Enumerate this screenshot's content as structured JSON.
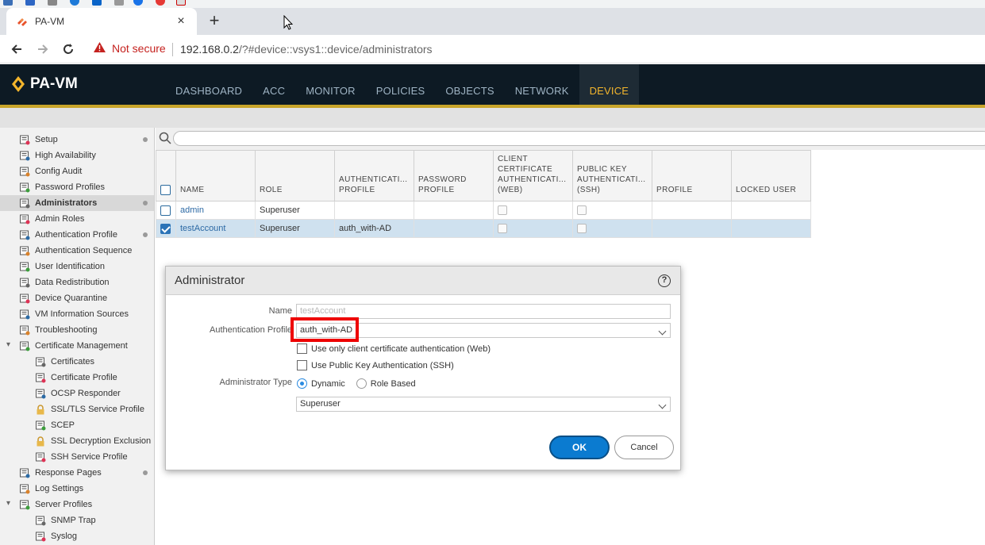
{
  "browser": {
    "tab_title": "PA-VM",
    "new_tab_label": "+",
    "security_label": "Not secure",
    "url_host": "192.168.0.2",
    "url_path": "/?#device::vsys1::device/administrators"
  },
  "app": {
    "logo": "PA-VM",
    "nav": [
      {
        "label": "DASHBOARD"
      },
      {
        "label": "ACC"
      },
      {
        "label": "MONITOR"
      },
      {
        "label": "POLICIES"
      },
      {
        "label": "OBJECTS"
      },
      {
        "label": "NETWORK"
      },
      {
        "label": "DEVICE",
        "active": true
      }
    ],
    "accent": "#f3b52c"
  },
  "sidebar": {
    "items": [
      {
        "label": "Setup",
        "icon": "setup-icon",
        "dot": true
      },
      {
        "label": "High Availability",
        "icon": "high-availability-icon"
      },
      {
        "label": "Config Audit",
        "icon": "config-audit-icon"
      },
      {
        "label": "Password Profiles",
        "icon": "password-profiles-icon"
      },
      {
        "label": "Administrators",
        "icon": "administrators-icon",
        "selected": true,
        "dot": true
      },
      {
        "label": "Admin Roles",
        "icon": "admin-roles-icon"
      },
      {
        "label": "Authentication Profile",
        "icon": "authentication-profile-icon",
        "dot": true
      },
      {
        "label": "Authentication Sequence",
        "icon": "authentication-sequence-icon"
      },
      {
        "label": "User Identification",
        "icon": "user-identification-icon"
      },
      {
        "label": "Data Redistribution",
        "icon": "data-redistribution-icon"
      },
      {
        "label": "Device Quarantine",
        "icon": "device-quarantine-icon"
      },
      {
        "label": "VM Information Sources",
        "icon": "vm-information-sources-icon"
      },
      {
        "label": "Troubleshooting",
        "icon": "troubleshooting-icon"
      },
      {
        "label": "Certificate Management",
        "icon": "certificate-management-icon",
        "expanded": true
      },
      {
        "label": "Certificates",
        "icon": "certificates-icon",
        "child": true
      },
      {
        "label": "Certificate Profile",
        "icon": "certificate-profile-icon",
        "child": true
      },
      {
        "label": "OCSP Responder",
        "icon": "ocsp-responder-icon",
        "child": true
      },
      {
        "label": "SSL/TLS Service Profile",
        "icon": "lock-icon",
        "child": true
      },
      {
        "label": "SCEP",
        "icon": "scep-icon",
        "child": true
      },
      {
        "label": "SSL Decryption Exclusion",
        "icon": "lock-icon",
        "child": true
      },
      {
        "label": "SSH Service Profile",
        "icon": "ssh-service-profile-icon",
        "child": true
      },
      {
        "label": "Response Pages",
        "icon": "response-pages-icon",
        "dot": true
      },
      {
        "label": "Log Settings",
        "icon": "log-settings-icon"
      },
      {
        "label": "Server Profiles",
        "icon": "server-profiles-icon",
        "expanded": true
      },
      {
        "label": "SNMP Trap",
        "icon": "snmp-trap-icon",
        "child": true
      },
      {
        "label": "Syslog",
        "icon": "syslog-icon",
        "child": true
      }
    ]
  },
  "table": {
    "columns": [
      "NAME",
      "ROLE",
      "AUTHENTICATI... PROFILE",
      "PASSWORD PROFILE",
      "CLIENT CERTIFICATE AUTHENTICATI... (WEB)",
      "PUBLIC KEY AUTHENTICATI... (SSH)",
      "PROFILE",
      "LOCKED USER"
    ],
    "rows": [
      {
        "name": "admin",
        "role": "Superuser",
        "auth_profile": "",
        "password_profile": "",
        "selected": false
      },
      {
        "name": "testAccount",
        "role": "Superuser",
        "auth_profile": "auth_with-AD",
        "password_profile": "",
        "selected": true
      }
    ]
  },
  "dialog": {
    "title": "Administrator",
    "name_label": "Name",
    "name_value": "testAccount",
    "auth_profile_label": "Authentication Profile",
    "auth_profile_value": "auth_with-AD",
    "client_cert_label": "Use only client certificate authentication (Web)",
    "pubkey_label": "Use Public Key Authentication (SSH)",
    "admin_type_label": "Administrator Type",
    "type_dynamic": "Dynamic",
    "type_role_based": "Role Based",
    "role_value": "Superuser",
    "ok_label": "OK",
    "cancel_label": "Cancel",
    "highlight_color": "#ee0000"
  }
}
